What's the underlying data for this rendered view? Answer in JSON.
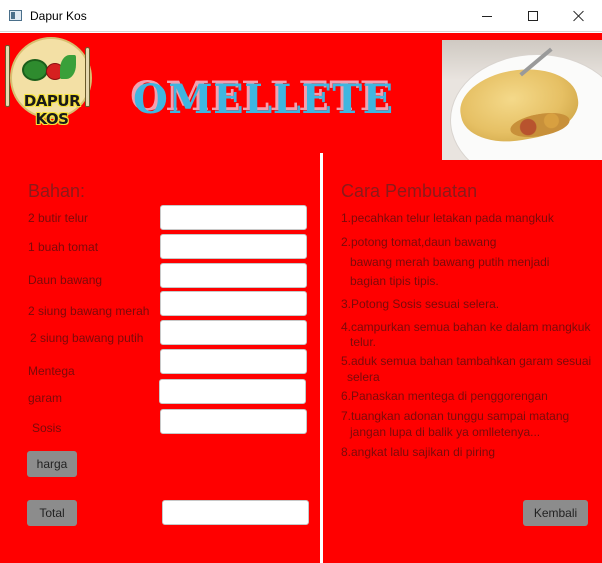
{
  "window": {
    "title": "Dapur Kos"
  },
  "header": {
    "logo_text": "DAPUR KOS",
    "dish_title": "OMELLETE"
  },
  "left": {
    "heading": "Bahan:",
    "ingredients": [
      {
        "label": "2 butir telur",
        "value": ""
      },
      {
        "label": "1 buah tomat",
        "value": ""
      },
      {
        "label": "Daun bawang",
        "value": ""
      },
      {
        "label": "2 siung bawang merah",
        "value": ""
      },
      {
        "label": "2 siung bawang putih",
        "value": ""
      },
      {
        "label": "Mentega",
        "value": ""
      },
      {
        "label": "garam",
        "value": ""
      },
      {
        "label": "Sosis",
        "value": ""
      }
    ],
    "harga_button": "harga",
    "total_button": "Total",
    "total_value": ""
  },
  "right": {
    "heading": "Cara Pembuatan",
    "steps": [
      "1.pecahkan telur letakan pada mangkuk",
      "2.potong tomat,daun bawang",
      "bawang merah bawang putih menjadi",
      "bagian tipis tipis.",
      "3.Potong Sosis sesuai selera.",
      "4.campurkan semua bahan ke dalam mangkuk",
      "telur.",
      "5.aduk semua bahan tambahkan garam sesuai",
      "selera",
      "6.Panaskan mentega di penggorengan",
      "7.tuangkan adonan tunggu sampai matang",
      "jangan lupa di balik ya omlletenya...",
      "8.angkat lalu sajikan di piring"
    ],
    "back_button": "Kembali"
  }
}
